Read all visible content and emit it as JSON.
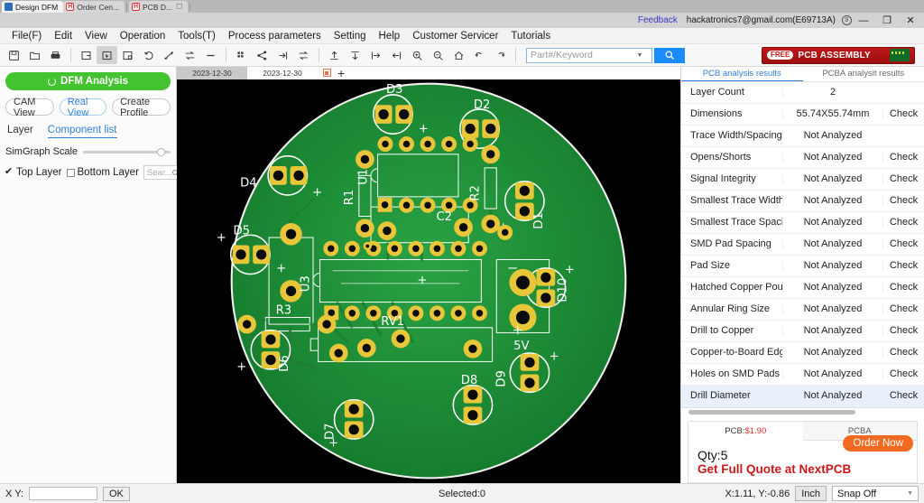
{
  "browser_tabs": [
    {
      "label": "Design DFM",
      "active": true,
      "icon": "app-icon"
    },
    {
      "label": "Order Cen...",
      "active": false,
      "icon": "h-icon"
    },
    {
      "label": "PCB D...",
      "active": false,
      "icon": "h-icon"
    }
  ],
  "titlebar": {
    "feedback": "Feedback",
    "account": "hackatronics7@gmail.com(E69713A)",
    "minimize": "—",
    "maximize": "❐",
    "close": "✕"
  },
  "menubar": {
    "items": [
      "File(F)",
      "Edit",
      "View",
      "Operation",
      "Tools(T)",
      "Process parameters",
      "Setting",
      "Help",
      "Customer Servicer",
      "Tutorials"
    ]
  },
  "toolbar": {
    "icons": [
      "save-icon",
      "open-folder-icon",
      "print-icon",
      "sep",
      "select-area-icon",
      "cursor-select-icon",
      "add-frame-icon",
      "rotate-icon",
      "measure-icon",
      "flip-icon",
      "line-icon",
      "sep",
      "panelize-icon",
      "share-icon",
      "import-icon",
      "export-icon",
      "sep",
      "align-top-icon",
      "align-bottom-icon",
      "align-left-icon",
      "align-right-icon",
      "zoom-in-icon",
      "zoom-out-icon",
      "home-icon",
      "undo-icon",
      "redo-icon"
    ],
    "search_placeholder": "Part#/Keyword",
    "search_value": "",
    "search_button": "search-icon",
    "banner": {
      "badge": "FREE",
      "text": "PCB ASSEMBLY"
    }
  },
  "left_panel": {
    "dfm_button": "DFM Analysis",
    "view_buttons": [
      {
        "label": "CAM View",
        "active": false
      },
      {
        "label": "Real View",
        "active": true
      },
      {
        "label": "Create Profile",
        "active": false
      }
    ],
    "tabs": [
      {
        "label": "Layer",
        "active": false
      },
      {
        "label": "Component list",
        "active": true
      }
    ],
    "scale_label": "SimGraph Scale",
    "layers": [
      {
        "label": "Top Layer",
        "checked": true
      },
      {
        "label": "Bottom Layer",
        "checked": false
      }
    ],
    "layer_search_placeholder": "Sear..."
  },
  "view_tabs": [
    {
      "label": "2023-12-30",
      "active": true
    },
    {
      "label": "2023-12-30",
      "active": false
    }
  ],
  "view_tab_controls": {
    "stop": "stop-icon",
    "add": "+"
  },
  "right_panel": {
    "tabs": [
      {
        "label": "PCB analysis results",
        "active": true
      },
      {
        "label": "PCBA analysit results",
        "active": false
      }
    ],
    "rows": [
      {
        "name": "Layer Count",
        "value": "2",
        "check": "",
        "highlight": false
      },
      {
        "name": "Dimensions",
        "value": "55.74X55.74mm",
        "check": "Check",
        "highlight": false
      },
      {
        "name": "Trace Width/Spacing",
        "value": "Not Analyzed",
        "check": "",
        "highlight": false
      },
      {
        "name": "Opens/Shorts",
        "value": "Not Analyzed",
        "check": "Check",
        "highlight": false
      },
      {
        "name": "Signal Integrity",
        "value": "Not Analyzed",
        "check": "Check",
        "highlight": false
      },
      {
        "name": "Smallest Trace Width",
        "value": "Not Analyzed",
        "check": "Check",
        "highlight": false
      },
      {
        "name": "Smallest Trace Spacing",
        "value": "Not Analyzed",
        "check": "Check",
        "highlight": false
      },
      {
        "name": "SMD Pad Spacing",
        "value": "Not Analyzed",
        "check": "Check",
        "highlight": false
      },
      {
        "name": "Pad Size",
        "value": "Not Analyzed",
        "check": "Check",
        "highlight": false
      },
      {
        "name": "Hatched Copper Pour",
        "value": "Not Analyzed",
        "check": "Check",
        "highlight": false
      },
      {
        "name": "Annular Ring Size",
        "value": "Not Analyzed",
        "check": "Check",
        "highlight": false
      },
      {
        "name": "Drill to Copper",
        "value": "Not Analyzed",
        "check": "Check",
        "highlight": false
      },
      {
        "name": "Copper-to-Board Edge",
        "value": "Not Analyzed",
        "check": "Check",
        "highlight": false
      },
      {
        "name": "Holes on SMD Pads",
        "value": "Not Analyzed",
        "check": "Check",
        "highlight": false
      },
      {
        "name": "Drill Diameter",
        "value": "Not Analyzed",
        "check": "Check",
        "highlight": true
      }
    ],
    "quote": {
      "tabs": [
        {
          "label": "PCB:",
          "price": "$1.90",
          "active": true
        },
        {
          "label": "PCBA",
          "price": "",
          "active": false
        }
      ],
      "qty": "Qty:5",
      "order_button": "Order Now",
      "full_quote": "Get Full Quote at NextPCB"
    }
  },
  "statusbar": {
    "xy_label": "X Y:",
    "xy_value": "",
    "ok_button": "OK",
    "selected": "Selected:0",
    "coords": "X:1.11, Y:-0.86",
    "unit": "Inch",
    "snap": "Snap Off"
  },
  "colors": {
    "accent_blue": "#2f80d8",
    "dfm_green": "#43c330",
    "banner_red": "#c01818",
    "order_orange": "#f26a21",
    "quote_red": "#c81818",
    "board_green": "#1f8a34",
    "pad_yellow": "#e8c63a",
    "silk_white": "#ffffff"
  },
  "pcb": {
    "silkscreen": [
      "D3",
      "D2",
      "D4",
      "D5",
      "D6",
      "D7",
      "D8",
      "D9",
      "D10",
      "D1",
      "R1",
      "R2",
      "R3",
      "U1",
      "U3",
      "C2",
      "RV1",
      "5V"
    ]
  }
}
